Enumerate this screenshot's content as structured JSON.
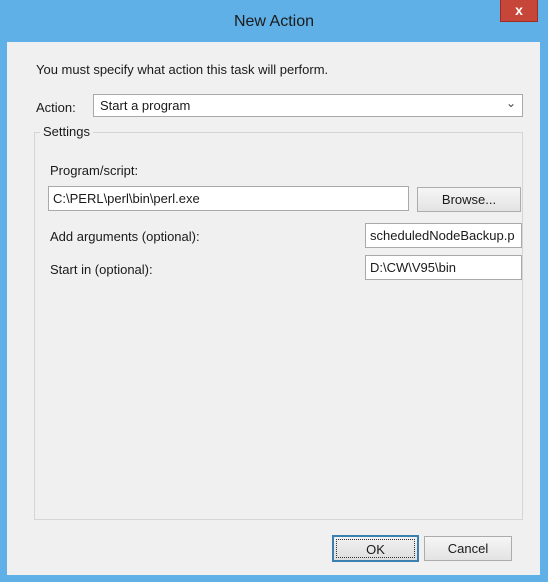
{
  "window": {
    "title": "New Action",
    "close_glyph": "x"
  },
  "dialog": {
    "instruction": "You must specify what action this task will perform.",
    "action_label": "Action:",
    "action_value": "Start a program",
    "settings_title": "Settings",
    "program_label": "Program/script:",
    "program_value": "C:\\PERL\\perl\\bin\\perl.exe",
    "browse_label": "Browse...",
    "args_label": "Add arguments (optional):",
    "args_value": "scheduledNodeBackup.p",
    "start_label": "Start in (optional):",
    "start_value": "D:\\CW\\V95\\bin"
  },
  "buttons": {
    "ok": "OK",
    "cancel": "Cancel"
  },
  "colors": {
    "window_frame": "#5fb0e6",
    "close_button": "#c7463a",
    "client_background": "#f0f0f0",
    "default_button_border": "#3c7fb1"
  },
  "icons": {
    "close": "close-icon",
    "dropdown": "chevron-down-icon"
  }
}
